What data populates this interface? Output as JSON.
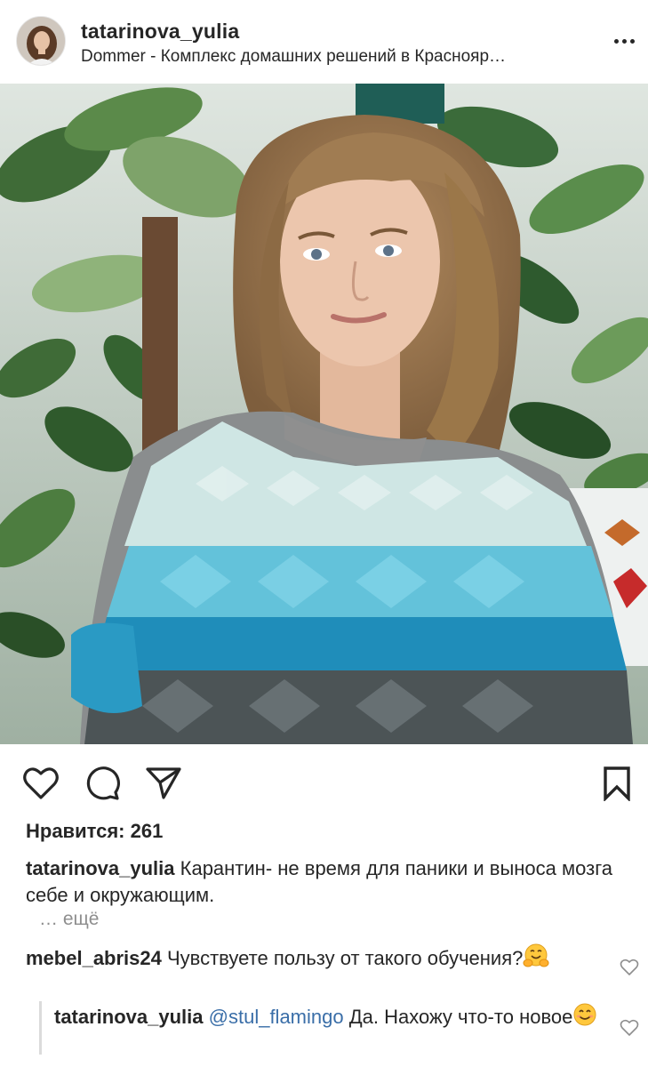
{
  "post": {
    "username": "tatarinova_yulia",
    "location": "Dommer - Комплекс домашних решений в Краснояр…",
    "likes": "Нравится: 261",
    "caption_user": "tatarinova_yulia",
    "caption_text": "Карантин- не время для паники и выноса мозга себе и окружающим.",
    "more": "… ещё"
  },
  "comments": [
    {
      "user": "mebel_abris24",
      "text": "Чувствуете пользу от такого обучения?",
      "emoji": "hugging-face"
    },
    {
      "user": "tatarinova_yulia",
      "mention": "@stul_flamingo",
      "text": "Да. Нахожу что-то новое",
      "emoji": "smiling-face"
    }
  ],
  "icons": {
    "more": "more-horizontal-icon",
    "like": "heart-icon",
    "comment": "comment-bubble-icon",
    "share": "paper-plane-icon",
    "save": "bookmark-icon"
  },
  "colors": {
    "text": "#262626",
    "secondary": "#8e8e8e",
    "mention": "#3a6ea8",
    "divider": "#dbdbdb"
  }
}
